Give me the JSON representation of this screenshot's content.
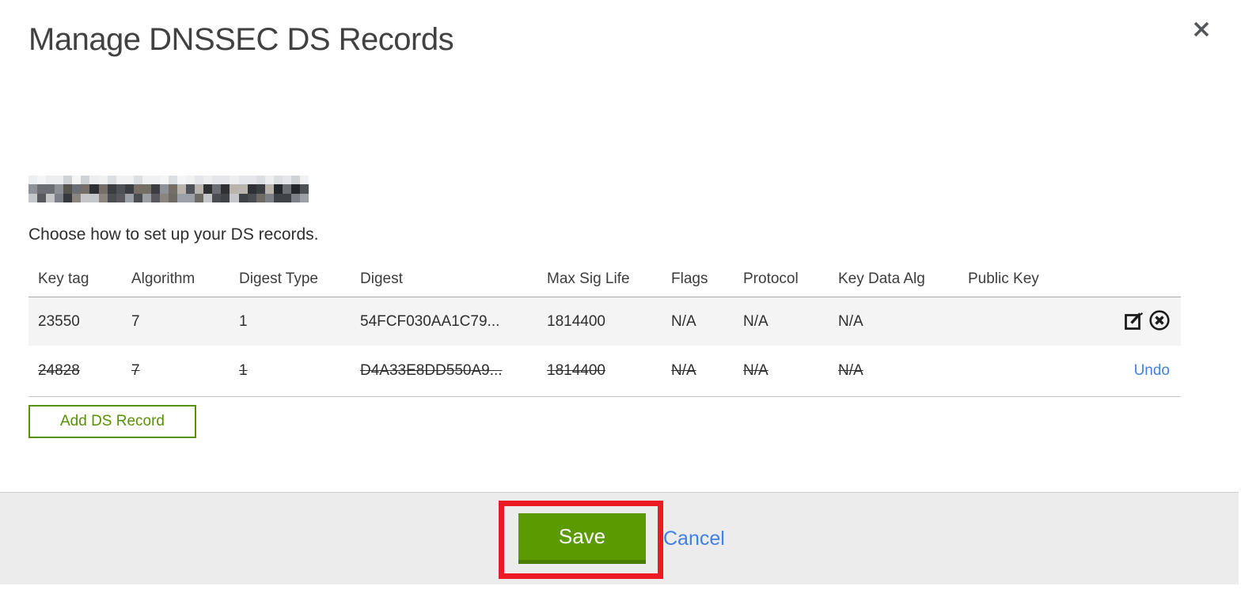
{
  "header": {
    "title": "Manage DNSSEC DS Records"
  },
  "intro": {
    "instruction": "Choose how to set up your DS records."
  },
  "table": {
    "columns": [
      "Key tag",
      "Algorithm",
      "Digest Type",
      "Digest",
      "Max Sig Life",
      "Flags",
      "Protocol",
      "Key Data Alg",
      "Public Key"
    ],
    "rows": [
      {
        "key_tag": "23550",
        "algorithm": "7",
        "digest_type": "1",
        "digest": "54FCF030AA1C79...",
        "max_sig_life": "1814400",
        "flags": "N/A",
        "protocol": "N/A",
        "key_data_alg": "N/A",
        "public_key": "",
        "state": "active"
      },
      {
        "key_tag": "24828",
        "algorithm": "7",
        "digest_type": "1",
        "digest": "D4A33E8DD550A9...",
        "max_sig_life": "1814400",
        "flags": "N/A",
        "protocol": "N/A",
        "key_data_alg": "N/A",
        "public_key": "",
        "state": "marked-for-deletion",
        "undo_label": "Undo"
      }
    ]
  },
  "buttons": {
    "add_ds_record": "Add DS Record",
    "save": "Save",
    "cancel": "Cancel"
  },
  "icons": {
    "close": "close-icon",
    "edit": "edit-record-icon",
    "delete": "delete-record-icon"
  },
  "colors": {
    "accent_green": "#5b9a00",
    "accent_green_dark": "#4a7d00",
    "link_blue": "#4080e8",
    "annotation_red": "#ec1b23",
    "row_highlight_gray": "#f4f4f4",
    "footer_gray": "#ececec"
  },
  "redacted_domain": {
    "rows": 3,
    "cols": 32,
    "palettes": [
      [
        "#eceef0",
        "#dcdfe2",
        "#f4f5f6",
        "#cfd3d6",
        "#e4e6e9",
        "#f0f1f2"
      ],
      [
        "#3a3d42",
        "#6b6f75",
        "#23262a",
        "#8e9298",
        "#4e5157",
        "#b9b4ae",
        "#55534e",
        "#2e3033",
        "#746e66",
        "#424549"
      ],
      [
        "#7d8187",
        "#4a4d52",
        "#9aa0a6",
        "#35383c",
        "#6e6a64",
        "#57595e",
        "#c4c6c9",
        "#3f4246",
        "#8a857e"
      ]
    ]
  }
}
